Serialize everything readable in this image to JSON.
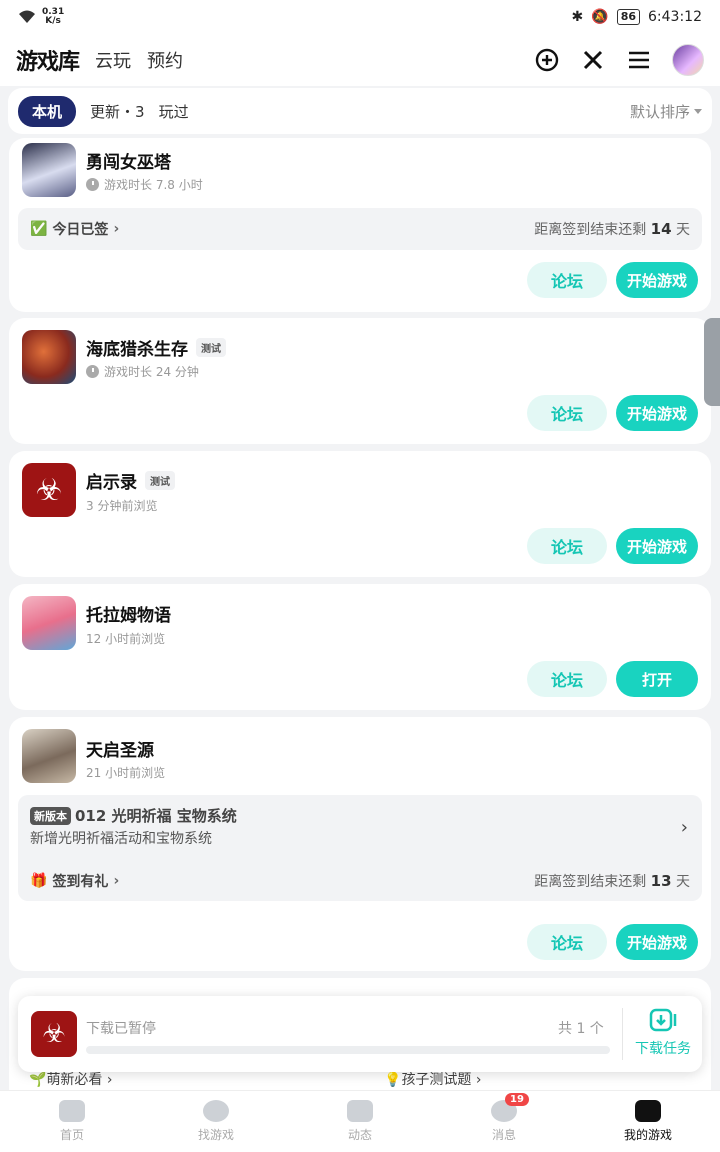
{
  "status": {
    "speed": "0.31\nK/s",
    "battery": "86",
    "time": "6:43:12"
  },
  "header": {
    "logo": "游戏库",
    "tabs": [
      "云玩",
      "预约"
    ]
  },
  "filter": {
    "active": "本机",
    "tabs": [
      "更新・3",
      "玩过"
    ],
    "sort": "默认排序"
  },
  "games": [
    {
      "name": "勇闯女巫塔",
      "sub": "游戏时长 7.8 小时",
      "sign_left": "今日已签",
      "sign_right_prefix": "距离签到结束还剩 ",
      "sign_days": "14",
      "sign_suffix": " 天",
      "forum": "论坛",
      "play": "开始游戏"
    },
    {
      "name": "海底猎杀生存",
      "tag": "测试",
      "sub": "游戏时长 24 分钟",
      "forum": "论坛",
      "play": "开始游戏"
    },
    {
      "name": "启示录",
      "tag": "测试",
      "sub": "3 分钟前浏览",
      "forum": "论坛",
      "play": "开始游戏"
    },
    {
      "name": "托拉姆物语",
      "sub": "12 小时前浏览",
      "forum": "论坛",
      "play": "打开"
    },
    {
      "name": "天启圣源",
      "sub": "21 小时前浏览",
      "update_badge": "新版本",
      "update_title": "012 光明祈福 宝物系统",
      "update_desc": "新增光明祈福活动和宝物系统",
      "sign_left": "签到有礼",
      "sign_right_prefix": "距离签到结束还剩 ",
      "sign_days": "13",
      "sign_suffix": " 天",
      "forum": "论坛",
      "play": "开始游戏"
    }
  ],
  "download": {
    "status": "下载已暂停",
    "count": "共 1 个",
    "task": "下载任务",
    "progress": 0
  },
  "peek": {
    "left": "萌新必看",
    "right": "孩子测试题"
  },
  "nav": {
    "items": [
      "首页",
      "找游戏",
      "动态",
      "消息",
      "我的游戏"
    ],
    "message_badge": "19",
    "active": "我的游戏"
  },
  "colors": {
    "accent": "#19d3c0",
    "navy": "#1f2a6e"
  }
}
